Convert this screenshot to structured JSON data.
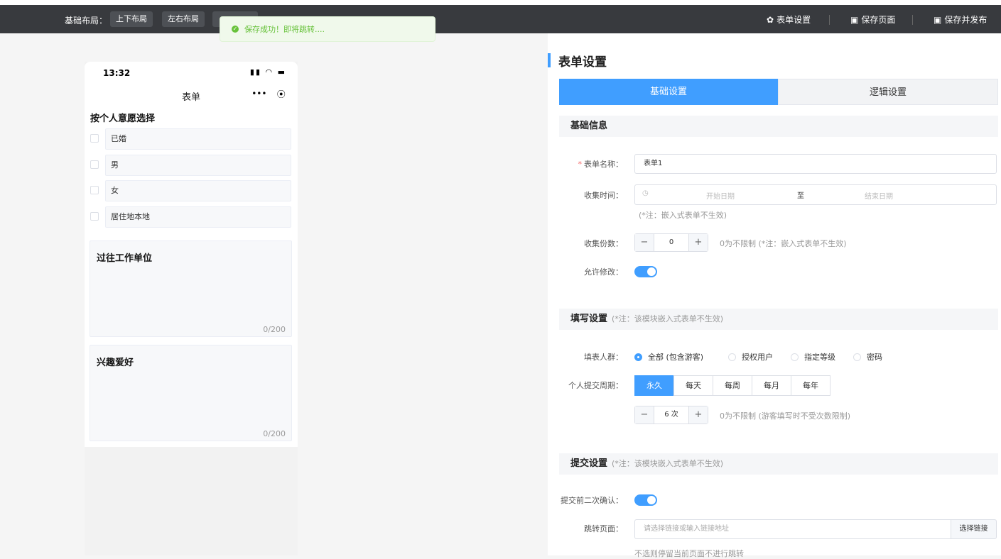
{
  "topbar": {
    "layout_label": "基础布局：",
    "layout_buttons": [
      "上下布局",
      "左右布局"
    ],
    "actions": {
      "form_settings": "表单设置",
      "save_page": "保存页面",
      "save_publish": "保存并发布"
    }
  },
  "toast": {
    "message": "保存成功！即将跳转...."
  },
  "phone": {
    "time": "13:32",
    "nav_title": "表单",
    "checkbox_question": {
      "title": "按个人意愿选择",
      "options": [
        "已婚",
        "男",
        "女",
        "居住地本地"
      ]
    },
    "textareas": [
      {
        "title": "过往工作单位",
        "count": "0/200"
      },
      {
        "title": "兴趣爱好",
        "count": "0/200"
      }
    ]
  },
  "panel": {
    "title": "表单设置",
    "tabs": [
      "基础设置",
      "逻辑设置"
    ],
    "basic_section": "基础信息",
    "form_name_label": "表单名称：",
    "form_name_value": "表单1",
    "collect_time_label": "收集时间：",
    "start_placeholder": "开始日期",
    "range_sep": "至",
    "end_placeholder": "结束日期",
    "collect_time_hint": "(*注：嵌入式表单不生效)",
    "collect_count_label": "收集份数：",
    "collect_count_value": "0",
    "collect_count_hint": "0为不限制 (*注：嵌入式表单不生效)",
    "allow_edit_label": "允许修改：",
    "fill_section": "填写设置",
    "fill_section_note": "(*注：该模块嵌入式表单不生效)",
    "audience_label": "填表人群：",
    "audience_options": [
      "全部 (包含游客)",
      "授权用户",
      "指定等级",
      "密码"
    ],
    "period_label": "个人提交周期：",
    "period_options": [
      "永久",
      "每天",
      "每周",
      "每月",
      "每年"
    ],
    "times_value": "6",
    "times_unit": "次",
    "times_hint": "0为不限制 (游客填写时不受次数限制)",
    "submit_section": "提交设置",
    "submit_section_note": "(*注：该模块嵌入式表单不生效)",
    "confirm_label": "提交前二次确认：",
    "redirect_label": "跳转页面：",
    "redirect_placeholder": "请选择链接或输入链接地址",
    "select_link": "选择链接",
    "bottom_hint": "不选则停留当前页面不进行跳转"
  }
}
